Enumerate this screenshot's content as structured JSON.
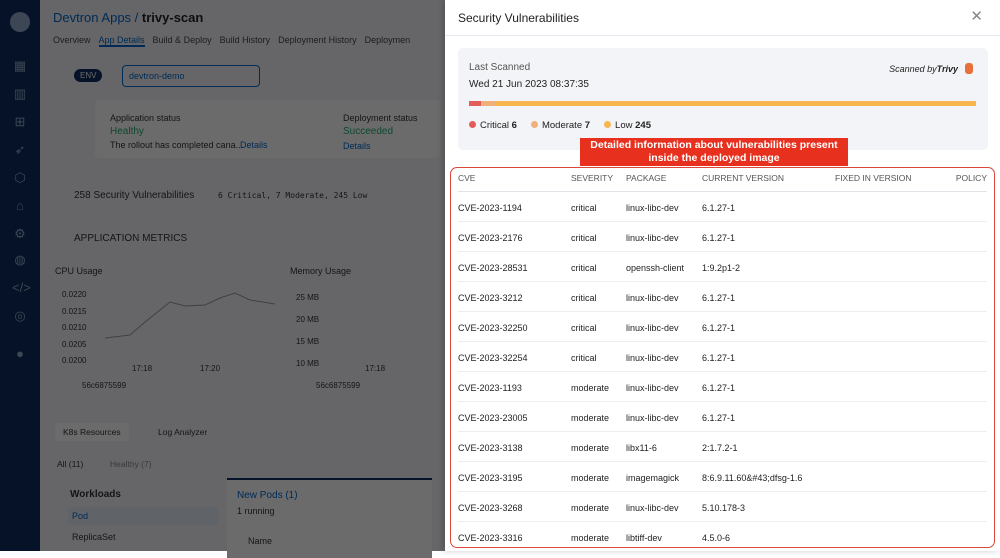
{
  "background": {
    "breadcrumb_parent": "Devtron Apps /",
    "app_name": "trivy-scan",
    "tabs": [
      "Overview",
      "App Details",
      "Build & Deploy",
      "Build History",
      "Deployment History",
      "Deploymen"
    ],
    "env_label": "ENV",
    "env_value": "devtron-demo",
    "app_status_label": "Application status",
    "app_status": "Healthy",
    "app_status_msg": "The rollout has completed cana...",
    "details": "Details",
    "deploy_status_label": "Deployment status",
    "deploy_status": "Succeeded",
    "vuln_summary": "258 Security Vulnerabilities",
    "vuln_counts": "6 Critical, 7 Moderate, 245 Low",
    "metrics_title": "APPLICATION METRICS",
    "cpu_title": "CPU Usage",
    "cpu_ticks": [
      "0.0220",
      "0.0215",
      "0.0210",
      "0.0205",
      "0.0200"
    ],
    "cpu_x": [
      "17:18",
      "17:20"
    ],
    "mem_title": "Memory Usage",
    "mem_ticks": [
      "25 MB",
      "20 MB",
      "15 MB",
      "10 MB"
    ],
    "mem_x": [
      "17:18"
    ],
    "series": "56c6875599",
    "k8s_tab": "K8s Resources",
    "log_tab": "Log Analyzer",
    "filter_all": "All (11)",
    "filter_healthy": "Healthy (7)",
    "workloads": "Workloads",
    "pod": "Pod",
    "replicaset": "ReplicaSet",
    "new_pods": "New Pods (1)",
    "running": "1 running",
    "name_col": "Name"
  },
  "panel": {
    "title": "Security Vulnerabilities",
    "last_scanned_label": "Last Scanned",
    "last_scanned": "Wed 21 Jun 2023 08:37:35",
    "scanned_by": "Scanned by",
    "scanner": "Trivy",
    "severity": [
      {
        "label": "Critical",
        "count": "6",
        "color": "#e35b5b"
      },
      {
        "label": "Moderate",
        "count": "7",
        "color": "#f0b07a"
      },
      {
        "label": "Low",
        "count": "245",
        "color": "#f8b650"
      }
    ],
    "annotation": "Detailed information about vulnerabilities present inside the deployed image",
    "columns": [
      "CVE",
      "SEVERITY",
      "PACKAGE",
      "CURRENT VERSION",
      "FIXED IN VERSION",
      "POLICY"
    ],
    "rows": [
      [
        "CVE-2023-1194",
        "critical",
        "linux-libc-dev",
        "6.1.27-1"
      ],
      [
        "CVE-2023-2176",
        "critical",
        "linux-libc-dev",
        "6.1.27-1"
      ],
      [
        "CVE-2023-28531",
        "critical",
        "openssh-client",
        "1:9.2p1-2"
      ],
      [
        "CVE-2023-3212",
        "critical",
        "linux-libc-dev",
        "6.1.27-1"
      ],
      [
        "CVE-2023-32250",
        "critical",
        "linux-libc-dev",
        "6.1.27-1"
      ],
      [
        "CVE-2023-32254",
        "critical",
        "linux-libc-dev",
        "6.1.27-1"
      ],
      [
        "CVE-2023-1193",
        "moderate",
        "linux-libc-dev",
        "6.1.27-1"
      ],
      [
        "CVE-2023-23005",
        "moderate",
        "linux-libc-dev",
        "6.1.27-1"
      ],
      [
        "CVE-2023-3138",
        "moderate",
        "libx11-6",
        "2:1.7.2-1"
      ],
      [
        "CVE-2023-3195",
        "moderate",
        "imagemagick",
        "8:6.9.11.60&#43;dfsg-1.6"
      ],
      [
        "CVE-2023-3268",
        "moderate",
        "linux-libc-dev",
        "5.10.178-3"
      ],
      [
        "CVE-2023-3316",
        "moderate",
        "libtiff-dev",
        "4.5.0-6"
      ]
    ]
  }
}
